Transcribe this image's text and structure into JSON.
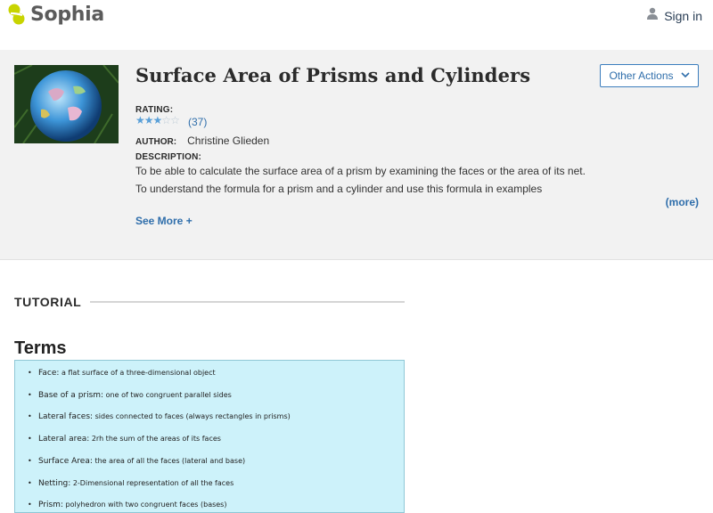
{
  "header": {
    "logo_text": "Sophia",
    "signin_label": "Sign in"
  },
  "lesson": {
    "title": "Surface Area of Prisms and Cylinders",
    "actions_label": "Other Actions",
    "rating_label": "RATING:",
    "rating_stars": 3,
    "rating_max": 5,
    "rating_count": "(37)",
    "author_label": "AUTHOR:",
    "author_name": "Christine Glieden",
    "description_label": "DESCRIPTION:",
    "description_lines": [
      "To be able to calculate the surface area of a prism by examining the faces or the area of its net.",
      "To understand the formula for a prism and a cylinder and use this formula in examples"
    ],
    "more_label": "(more)",
    "see_more_label": "See More +"
  },
  "tutorial": {
    "section_label": "TUTORIAL",
    "terms_title": "Terms",
    "terms": [
      {
        "name": "Face:",
        "definition": "a flat surface of a three-dimensional object"
      },
      {
        "name": "Base of a prism:",
        "definition": "one of two congruent parallel sides"
      },
      {
        "name": "Lateral faces:",
        "definition": "sides connected to faces (always rectangles in prisms)"
      },
      {
        "name": "Lateral area:",
        "definition": "2rh   the sum of the areas of its faces"
      },
      {
        "name": "Surface Area:",
        "definition": "the area of all the faces (lateral and base)"
      },
      {
        "name": "Netting:",
        "definition": "2-Dimensional representation of all the faces"
      },
      {
        "name": "Prism:",
        "definition": "polyhedron with two congruent faces (bases)"
      }
    ]
  },
  "colors": {
    "brand_yellow": "#c8d400",
    "link_blue": "#2f6eab",
    "star_on": "#5aa0d8",
    "terms_bg": "#cdf2fa"
  },
  "icons": {
    "logo": "sophia-logo-icon",
    "user": "user-icon",
    "chevron": "chevron-down-icon",
    "star": "star-icon"
  }
}
